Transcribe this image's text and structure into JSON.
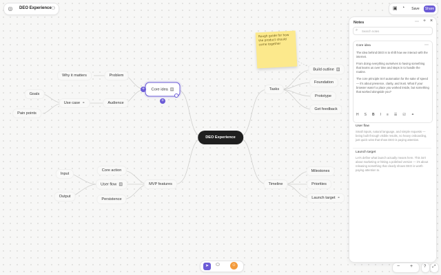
{
  "header": {
    "title": "DEO Experience"
  },
  "topbar": {
    "save_label": "Save",
    "share_label": "Share",
    "accent": "#6b5bd6"
  },
  "map": {
    "root": "DEO Experience",
    "core_idea": "Core idea",
    "problem": "Problem",
    "why_it_matters": "Why it matters",
    "audience": "Audience",
    "use_case": "Use case",
    "goals": "Goals",
    "pain_points": "Pain points",
    "mvp_features": "MVP features",
    "core_action": "Core action",
    "user_flow": "User flow",
    "persistence": "Persistence",
    "input": "Input",
    "output": "Output",
    "tasks": "Tasks",
    "build_outline": "Build outline",
    "foundation": "Foundation",
    "prototype": "Prototype",
    "get_feedback": "Get feedback",
    "timeline": "Timeline",
    "milestones": "Milestones",
    "priorities": "Priorities",
    "launch_target": "Launch target"
  },
  "sticky_note": "Rough guide for how the product should come together",
  "notes_panel": {
    "title": "Notes",
    "search_placeholder": "Search notes",
    "notes": [
      {
        "title": "Core idea",
        "paragraphs": [
          "The idea behind DEO is to shift how we interact with the internet.",
          "From doing everything ourselves to having something that learns us over time and steps in to handle the routine.",
          "The core principle isn't automation for the sake of speed — it's about presence, clarity, and trust. What if your browser wasn't a place you worked inside, but something that worked alongside you?"
        ]
      },
      {
        "title": "User flow",
        "paragraphs": [
          "Small inputs, natural language, and simple requests — being built through visible results, no heavy onboarding, just quick wins that show DEO is paying attention."
        ]
      },
      {
        "title": "Launch target",
        "paragraphs": [
          "Let's define what launch actually means here. This isn't about marketing or hitting a polished version — it's about releasing something that clearly shows DEO is worth paying attention to."
        ]
      }
    ]
  },
  "zoom": {
    "minus": "−",
    "plus": "+",
    "help": "?"
  }
}
